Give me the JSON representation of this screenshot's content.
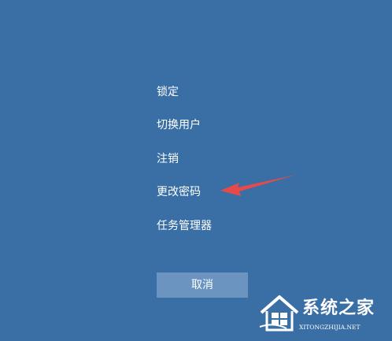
{
  "menu": {
    "items": [
      {
        "label": "锁定"
      },
      {
        "label": "切换用户"
      },
      {
        "label": "注销"
      },
      {
        "label": "更改密码"
      },
      {
        "label": "任务管理器"
      }
    ]
  },
  "cancel_button": {
    "label": "取消"
  },
  "annotation": {
    "icon": "red-arrow-icon",
    "color": "#e84a4a"
  },
  "watermark": {
    "title": "系统之家",
    "subtitle": "XITONGZHIJIA.NET",
    "icon": "house-logo-icon"
  },
  "colors": {
    "background": "#3a6fa6",
    "button": "#6b94c1",
    "text": "#ffffff"
  }
}
